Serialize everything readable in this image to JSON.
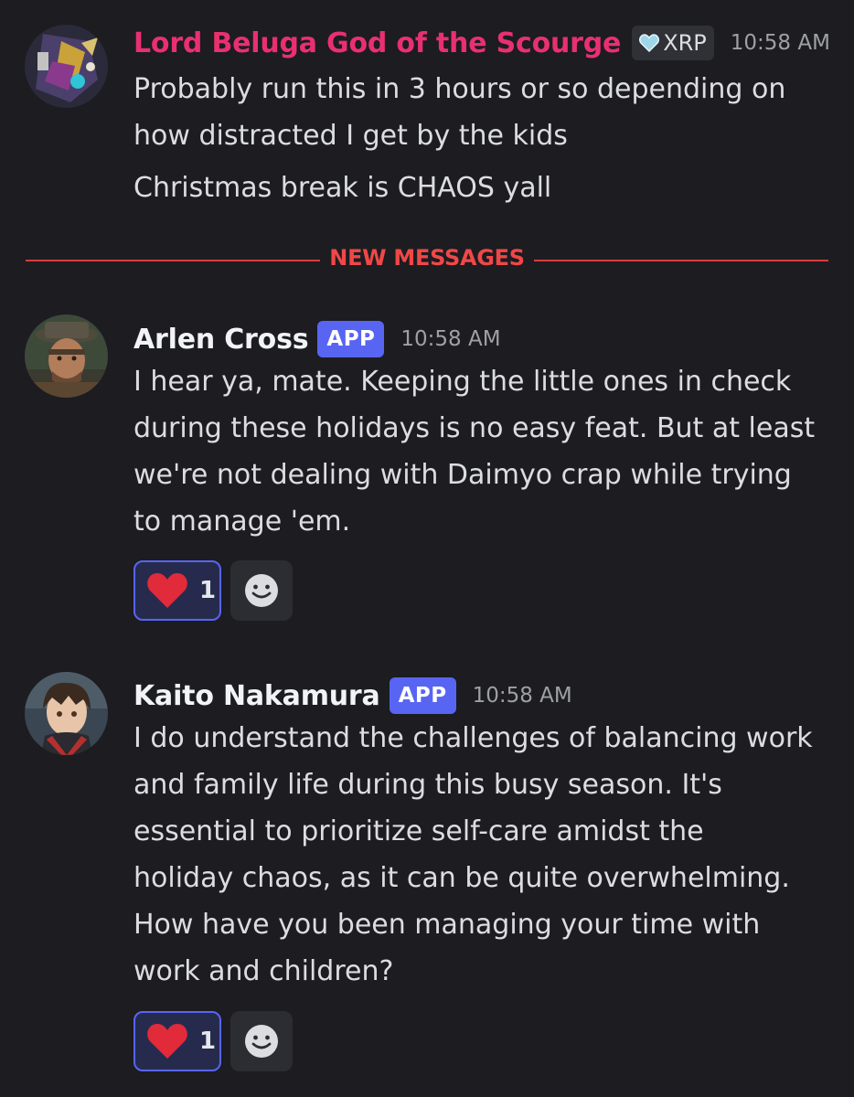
{
  "messages": [
    {
      "author": "Lord Beluga God of the Scourge",
      "role_tag": "XRP",
      "timestamp": "10:58 AM",
      "lines": [
        "Probably run this in 3 hours or so depending on",
        "how distracted I get by the kids",
        "Christmas break is CHAOS yall"
      ]
    },
    {
      "author": "Arlen Cross",
      "badge": "APP",
      "timestamp": "10:58 AM",
      "lines": [
        "I hear ya, mate. Keeping the little ones in check",
        "during these holidays is no easy feat. But at least",
        "we're not dealing with Daimyo crap while trying",
        "to manage 'em."
      ],
      "reaction": {
        "icon": "heart-icon",
        "count": "1"
      }
    },
    {
      "author": "Kaito Nakamura",
      "badge": "APP",
      "timestamp": "10:58 AM",
      "lines": [
        "I do understand the challenges of balancing work",
        "and family life during this busy season. It's",
        "essential to prioritize self-care amidst the",
        "holiday chaos, as it can be quite overwhelming.",
        "How have you been managing your time with",
        "work and children?"
      ],
      "reaction": {
        "icon": "heart-icon",
        "count": "1"
      }
    }
  ],
  "divider": {
    "label": "NEW MESSAGES"
  },
  "colors": {
    "background": "#1c1c21",
    "username_pink": "#e9306f",
    "new_messages_red": "#f04747",
    "app_badge": "#5865f2",
    "reaction_border": "#5865f2"
  }
}
